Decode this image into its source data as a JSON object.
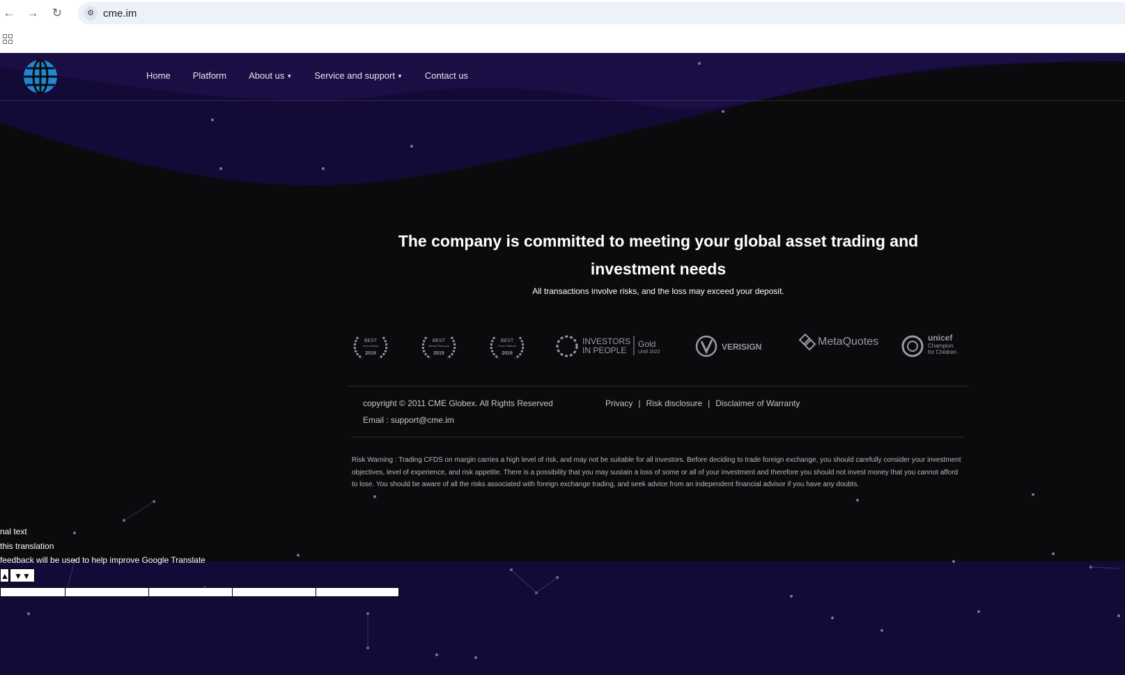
{
  "browser": {
    "url": "cme.im",
    "back_icon": "arrow-left-icon",
    "forward_icon": "arrow-right-icon",
    "reload_icon": "reload-icon",
    "site_info_icon": "tune-icon",
    "apps_icon": "apps-grid-icon"
  },
  "nav": {
    "items": [
      {
        "label": "Home",
        "dropdown": false
      },
      {
        "label": "Platform",
        "dropdown": false
      },
      {
        "label": "About us",
        "dropdown": true
      },
      {
        "label": "Service and support",
        "dropdown": true
      },
      {
        "label": "Contact us",
        "dropdown": false
      }
    ]
  },
  "hero": {
    "title": "The company is committed to meeting your global asset trading and investment needs",
    "subtitle": "All transactions involve risks, and the loss may exceed your deposit."
  },
  "badges": {
    "award1": {
      "top": "BEST",
      "mid": "Forex Broker",
      "year": "2019"
    },
    "award2": {
      "top": "BEST",
      "mid": "Market Research",
      "year": "2019"
    },
    "award3": {
      "top": "BEST",
      "mid": "Forex Platform",
      "year": "2019"
    },
    "iip": {
      "line1": "INVESTORS",
      "line2": "IN PEOPLE",
      "gold": "Gold",
      "until": "Until 2022"
    },
    "verisign": "VERISIGN",
    "metaquotes": "MetaQuotes",
    "unicef": {
      "line1": "unicef",
      "line2": "Champion",
      "line3": "for Children"
    }
  },
  "footer": {
    "copyright": "copyright © 2011 CME Globex. All Rights Reserved",
    "email": "Email : support@cme.im",
    "links": [
      "Privacy",
      "Risk disclosure",
      "Disclaimer of Warranty"
    ],
    "separator": "|",
    "risk_warning": "Risk Warning : Trading CFDS on margin carries a high level of risk, and may not be suitable for all investors. Before deciding to trade foreign exchange, you should carefully consider your investment objectives, level of experience, and risk appetite. There is a possibility that you may sustain a loss of some or all of your investment and therefore you should not invest money that you cannot afford to lose. You should be aware of all the risks associated with foreign exchange trading, and seek advice from an independent financial advisor if you have any doubts."
  },
  "translate_overlay": {
    "line1": "nal text",
    "line2": "this translation",
    "line3": "feedback will be used to help improve Google Translate",
    "thumb_up_icon": "thumb-up-icon",
    "thumb_down_icon": "thumb-down-icon"
  },
  "colors": {
    "page_bg": "#140a38",
    "dark_band": "#0b0b0d",
    "logo_blue": "#1e88d6"
  }
}
